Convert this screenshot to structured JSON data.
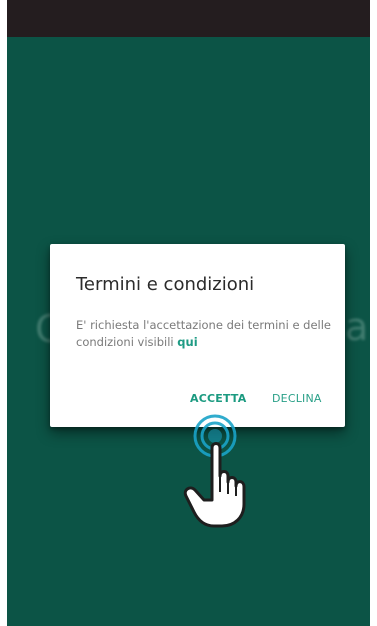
{
  "dialog": {
    "title": "Termini e condizioni",
    "message": "E' richiesta l'accettazione dei termini e delle condizioni visibili",
    "link_label": "qui",
    "accept_label": "ACCETTA",
    "decline_label": "DECLINA"
  },
  "colors": {
    "background": "#0c5446",
    "status_bar": "#241d1f",
    "accent": "#1b9a80",
    "touch_ring": "#1aa3c8"
  },
  "icons": {
    "tap_indicator": "pointing-hand-icon"
  }
}
